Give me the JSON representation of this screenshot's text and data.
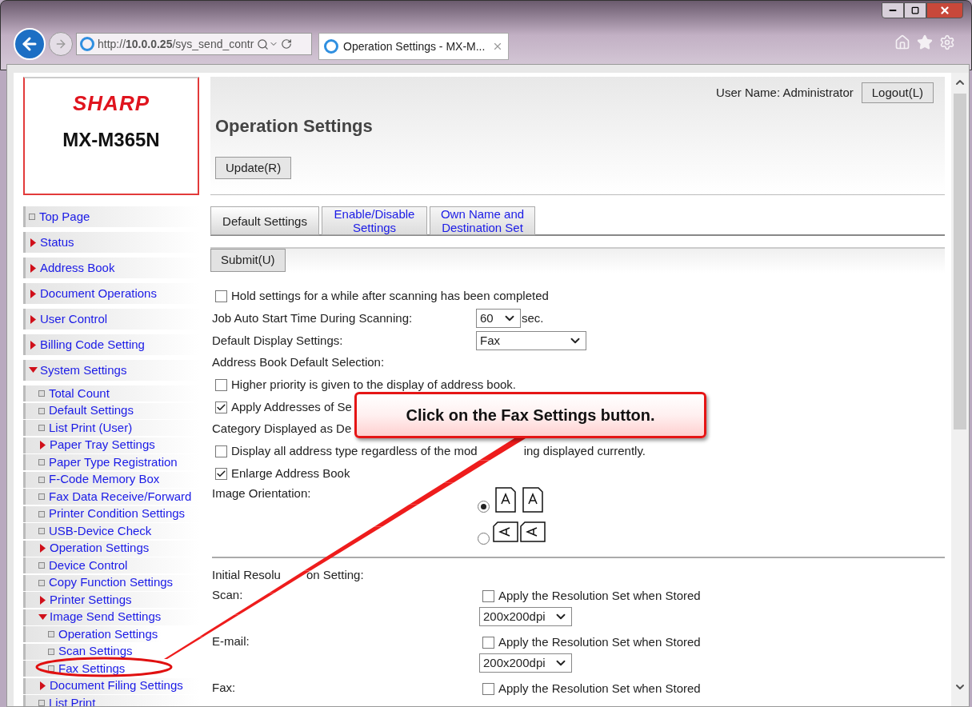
{
  "browser": {
    "url": "http://**10.0.0.25**/sys_send_contr",
    "tab_title": "Operation Settings - MX-M..."
  },
  "logo": {
    "brand": "SHARP",
    "model": "MX-M365N"
  },
  "sidebar": {
    "items": [
      {
        "label": "Top Page",
        "kind": "page"
      },
      {
        "label": "Status",
        "kind": "folder",
        "expanded": false
      },
      {
        "label": "Address Book",
        "kind": "folder",
        "expanded": false
      },
      {
        "label": "Document Operations",
        "kind": "folder",
        "expanded": false
      },
      {
        "label": "User Control",
        "kind": "folder",
        "expanded": false
      },
      {
        "label": "Billing Code Setting",
        "kind": "folder",
        "expanded": false
      },
      {
        "label": "System Settings",
        "kind": "folder",
        "expanded": true,
        "children": [
          {
            "label": "Total Count",
            "kind": "page"
          },
          {
            "label": "Default Settings",
            "kind": "page"
          },
          {
            "label": "List Print (User)",
            "kind": "page"
          },
          {
            "label": "Paper Tray Settings",
            "kind": "folder",
            "expanded": false
          },
          {
            "label": "Paper Type Registration",
            "kind": "page"
          },
          {
            "label": "F-Code Memory Box",
            "kind": "page"
          },
          {
            "label": "Fax Data Receive/Forward",
            "kind": "page"
          },
          {
            "label": "Printer Condition Settings",
            "kind": "page"
          },
          {
            "label": "USB-Device Check",
            "kind": "page"
          },
          {
            "label": "Operation Settings",
            "kind": "folder",
            "expanded": false
          },
          {
            "label": "Device Control",
            "kind": "page"
          },
          {
            "label": "Copy Function Settings",
            "kind": "page"
          },
          {
            "label": "Printer Settings",
            "kind": "folder",
            "expanded": false
          },
          {
            "label": "Image Send Settings",
            "kind": "folder",
            "expanded": true,
            "children": [
              {
                "label": "Operation Settings",
                "kind": "page"
              },
              {
                "label": "Scan Settings",
                "kind": "page"
              },
              {
                "label": "Fax Settings",
                "kind": "page"
              }
            ]
          },
          {
            "label": "Document Filing Settings",
            "kind": "folder",
            "expanded": false
          },
          {
            "label": "List Print",
            "kind": "page"
          }
        ]
      }
    ]
  },
  "header": {
    "user": "User Name: Administrator",
    "logout": "Logout(L)",
    "title": "Operation Settings",
    "update": "Update(R)"
  },
  "tabs": [
    {
      "label": "Default Settings",
      "selected": true
    },
    {
      "label": "Enable/Disable Settings",
      "selected": false
    },
    {
      "label": "Own Name and Destination Set",
      "selected": false
    }
  ],
  "submit": "Submit(U)",
  "form": [
    {
      "kind": "checkbox",
      "label": "Hold settings for a while after scanning has been completed",
      "checked": false
    },
    {
      "kind": "select",
      "label": "Job Auto Start Time During Scanning:",
      "value": "60",
      "suffix": "sec."
    },
    {
      "kind": "select",
      "label": "Default Display Settings:",
      "value": "Fax"
    },
    {
      "kind": "heading",
      "label": "Address Book Default Selection:"
    },
    {
      "kind": "checkbox",
      "label": "Higher priority is given to the display of address book.",
      "checked": false
    },
    {
      "kind": "checkbox",
      "label": "Apply Addresses of Se",
      "checked": true
    },
    {
      "kind": "heading",
      "label": "Category Displayed as De"
    },
    {
      "kind": "checkbox",
      "label": "Display all address type regardless of the mod",
      "rest": "ing displayed currently.",
      "checked": false
    },
    {
      "kind": "checkbox",
      "label": "Enlarge Address Book",
      "checked": true
    },
    {
      "kind": "orientation",
      "label": "Image Orientation:",
      "options": [
        {
          "selected": true
        },
        {
          "selected": false
        }
      ]
    },
    {
      "kind": "divider"
    },
    {
      "kind": "heading",
      "label": "Initial Resolu",
      "rest": "on Setting:"
    },
    {
      "kind": "resolution",
      "label": "Scan:",
      "check_label": "Apply the Resolution Set when Stored",
      "checked": false,
      "value": "200x200dpi"
    },
    {
      "kind": "resolution",
      "label": "E-mail:",
      "check_label": "Apply the Resolution Set when Stored",
      "checked": false,
      "value": "200x200dpi"
    },
    {
      "kind": "resolution",
      "label": "Fax:",
      "check_label": "Apply the Resolution Set when Stored",
      "checked": false
    }
  ],
  "callout": {
    "text": "Click on the Fax Settings button."
  }
}
